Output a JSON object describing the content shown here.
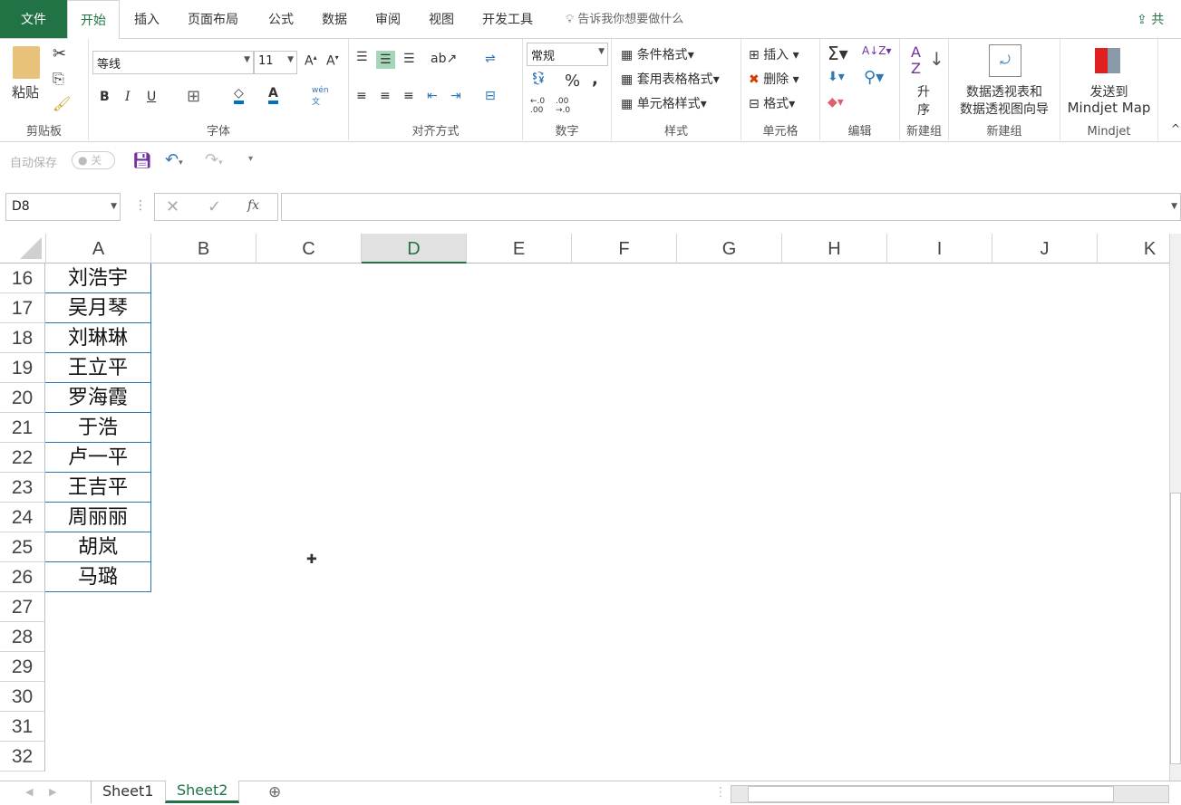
{
  "tabs": [
    "文件",
    "开始",
    "插入",
    "页面布局",
    "公式",
    "数据",
    "审阅",
    "视图",
    "开发工具"
  ],
  "tell_me": "告诉我你想要做什么",
  "share": "共享",
  "ribbon": {
    "clipboard": {
      "paste": "粘贴",
      "label": "剪贴板"
    },
    "font": {
      "name": "等线",
      "size": "11",
      "bold": "B",
      "italic": "I",
      "underline": "U",
      "label": "字体",
      "phonetic": "wén"
    },
    "alignment": {
      "label": "对齐方式"
    },
    "number": {
      "format": "常规",
      "percent": "%",
      "comma": ",",
      "label": "数字"
    },
    "styles": {
      "conditional": "条件格式",
      "table": "套用表格格式",
      "cell": "单元格样式",
      "label": "样式"
    },
    "cells": {
      "insert": "插入",
      "delete": "删除",
      "format": "格式",
      "label": "单元格"
    },
    "editing": {
      "label": "编辑"
    },
    "sort": {
      "text1": "升",
      "text2": "序",
      "label": "新建组"
    },
    "pivot": {
      "text1": "数据透视表和",
      "text2": "数据透视图向导",
      "label": "新建组"
    },
    "mindjet": {
      "text1": "发送到",
      "text2": "Mindjet Map",
      "label": "Mindjet"
    }
  },
  "qat": {
    "autosave": "自动保存",
    "toggle": "关"
  },
  "formula": {
    "name_box": "D8",
    "fx": "fx",
    "value": ""
  },
  "columns": [
    "A",
    "B",
    "C",
    "D",
    "E",
    "F",
    "G",
    "H",
    "I",
    "J",
    "K"
  ],
  "selected_column": "D",
  "rows": [
    {
      "n": "16",
      "a": "刘浩宇"
    },
    {
      "n": "17",
      "a": "吴月琴"
    },
    {
      "n": "18",
      "a": "刘琳琳"
    },
    {
      "n": "19",
      "a": "王立平"
    },
    {
      "n": "20",
      "a": "罗海霞"
    },
    {
      "n": "21",
      "a": "于浩"
    },
    {
      "n": "22",
      "a": "卢一平"
    },
    {
      "n": "23",
      "a": "王吉平"
    },
    {
      "n": "24",
      "a": "周丽丽"
    },
    {
      "n": "25",
      "a": "胡岚"
    },
    {
      "n": "26",
      "a": "马璐"
    },
    {
      "n": "27",
      "a": ""
    },
    {
      "n": "28",
      "a": ""
    },
    {
      "n": "29",
      "a": ""
    },
    {
      "n": "30",
      "a": ""
    },
    {
      "n": "31",
      "a": ""
    },
    {
      "n": "32",
      "a": ""
    }
  ],
  "sheets": [
    "Sheet1",
    "Sheet2"
  ],
  "active_sheet": "Sheet2",
  "colors": {
    "accent": "#217346",
    "cell_border": "#2e75b6"
  }
}
